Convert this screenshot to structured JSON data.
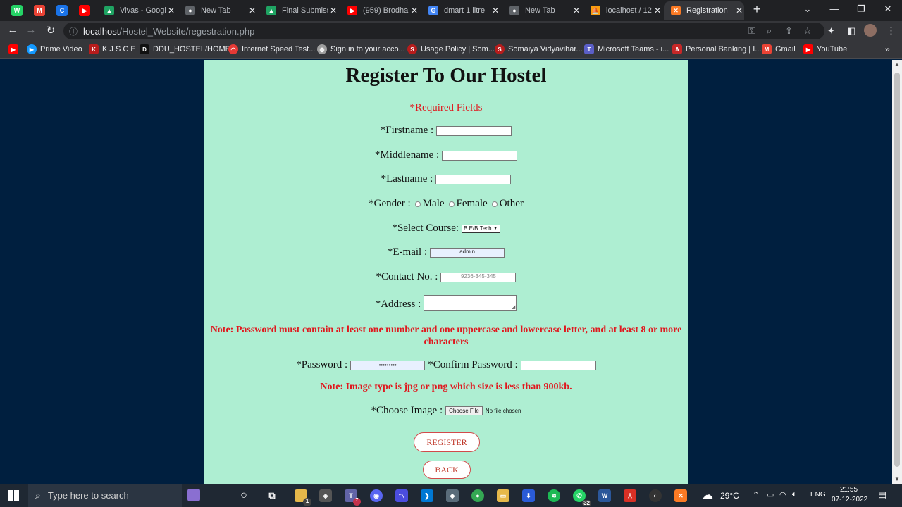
{
  "browser": {
    "tabs": [
      {
        "title": "Vivas - Googl",
        "favicon": "google-drive-icon",
        "color": "#1fa463"
      },
      {
        "title": "New Tab",
        "favicon": "chrome-icon",
        "color": "#5f6368"
      },
      {
        "title": "Final Submiss",
        "favicon": "google-drive-icon",
        "color": "#1fa463"
      },
      {
        "title": "(959) Brodha",
        "favicon": "youtube-icon",
        "color": "#ff0000"
      },
      {
        "title": "dmart 1 litre",
        "favicon": "google-icon",
        "color": "#4285f4"
      },
      {
        "title": "New Tab",
        "favicon": "chrome-icon",
        "color": "#5f6368"
      },
      {
        "title": "localhost / 12",
        "favicon": "phpmyadmin-icon",
        "color": "#f89c0e"
      },
      {
        "title": "Registration",
        "favicon": "xampp-icon",
        "color": "#fb7a24"
      }
    ],
    "url_host": "localhost",
    "url_path": "/Hostel_Website/regestration.php",
    "bookmarks": [
      {
        "label": "Prime Video",
        "icon": "prime-video-icon",
        "color": "#1399ff"
      },
      {
        "label": "K J S C E",
        "icon": "kjsce-icon",
        "color": "#b71c1c"
      },
      {
        "label": "DDU_HOSTEL/HOME",
        "icon": "ddu-icon",
        "color": "#111111"
      },
      {
        "label": "Internet Speed Test...",
        "icon": "speedtest-icon",
        "color": "#e53935"
      },
      {
        "label": "Sign in to your acco...",
        "icon": "globe-icon",
        "color": "#9e9e9e"
      },
      {
        "label": "Usage Policy | Som...",
        "icon": "somaiya-icon",
        "color": "#b71c1c"
      },
      {
        "label": "Somaiya Vidyavihar...",
        "icon": "somaiya-icon",
        "color": "#b71c1c"
      },
      {
        "label": "Microsoft Teams - i...",
        "icon": "teams-icon",
        "color": "#5b5fc7"
      },
      {
        "label": "Personal Banking | I...",
        "icon": "bank-icon",
        "color": "#c62828"
      },
      {
        "label": "Gmail",
        "icon": "gmail-icon",
        "color": "#ea4335"
      },
      {
        "label": "YouTube",
        "icon": "youtube-icon",
        "color": "#ff0000"
      }
    ]
  },
  "form": {
    "title": "Register To Our Hostel",
    "required_note": "*Required Fields",
    "firstname_label": "*Firstname :",
    "middlename_label": "*Middlename :",
    "lastname_label": "*Lastname :",
    "gender_label": "*Gender :",
    "gender_options": [
      "Male",
      "Female",
      "Other"
    ],
    "course_label": "*Select Course:",
    "course_value": "B.E/B.Tech",
    "email_label": "*E-mail :",
    "email_value": "admin",
    "contact_label": "*Contact No. :",
    "contact_placeholder": "9236-345-345",
    "address_label": "*Address :",
    "password_note": "Note: Password must contain at least one number and one uppercase and lowercase letter, and at least 8 or more characters",
    "password_label": "*Password :",
    "password_value": "•••••••••",
    "confirm_label": "*Confirm Password :",
    "image_note": "Note: Image type is jpg or png which size is less than 900kb.",
    "image_label": "*Choose Image :",
    "file_button": "Choose File",
    "file_status": "No file chosen",
    "register_button": "REGISTER",
    "back_button": "BACK"
  },
  "taskbar": {
    "search_placeholder": "Type here to search",
    "weather": "29°C",
    "language": "ENG",
    "time": "21:55",
    "date": "07-12-2022",
    "teams_badge": "7",
    "whatsapp_badge": "32",
    "explorer_badge": "1"
  }
}
